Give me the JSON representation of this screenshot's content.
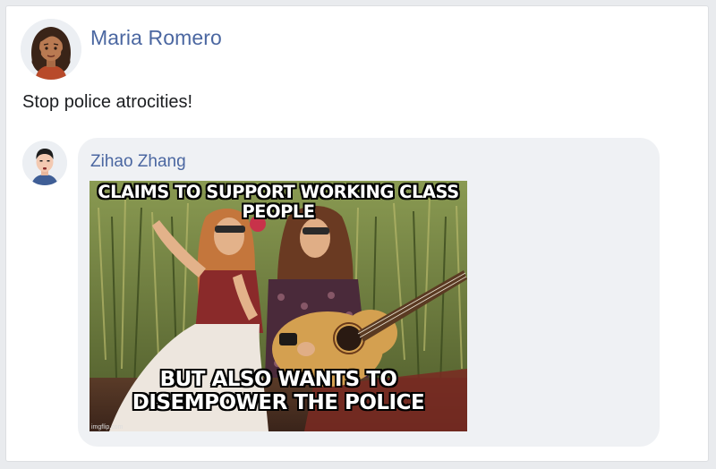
{
  "post": {
    "author": "Maria Romero",
    "text": "Stop police atrocities!"
  },
  "comment": {
    "author": "Zihao Zhang",
    "meme": {
      "top_text": "CLAIMS TO SUPPORT WORKING CLASS PEOPLE",
      "bottom_line1": "BUT ALSO WANTS TO",
      "bottom_line2": "DISEMPOWER THE POLICE",
      "watermark": "imgflip.com"
    }
  },
  "icons": {
    "post_avatar": "woman-avatar-icon",
    "comment_avatar": "man-avatar-icon"
  },
  "colors": {
    "name_link": "#4b67a1",
    "bubble_bg": "#eff1f4",
    "page_bg": "#e9ebee"
  }
}
